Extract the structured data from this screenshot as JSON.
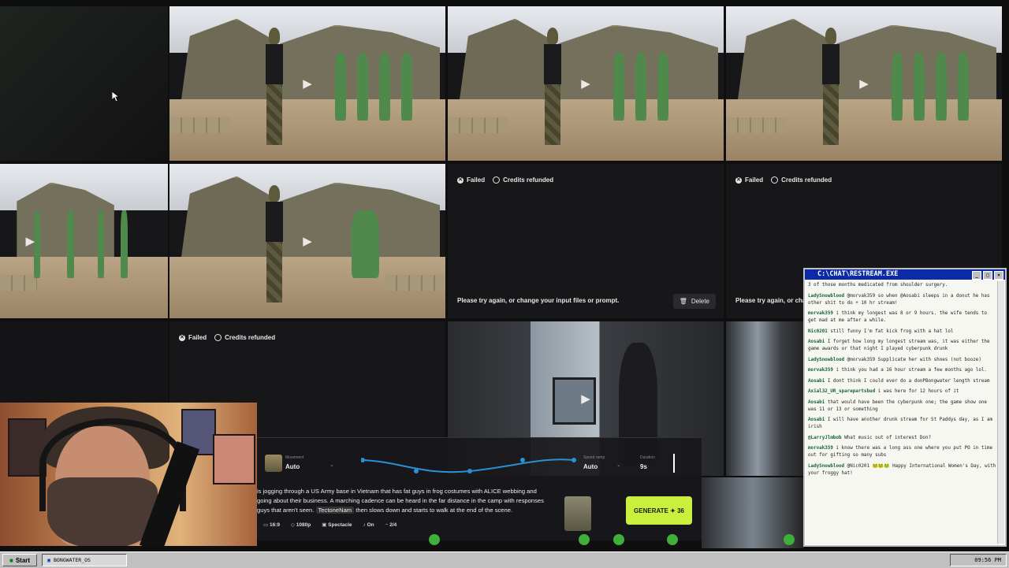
{
  "gallery": {
    "failed_status": "Failed",
    "credits_status": "Credits refunded",
    "retry_message": "Please try again, or change your input files or prompt.",
    "retry_message_cut": "Please try again, or char",
    "delete_label": "Delete"
  },
  "controls": {
    "movement_label": "Movement",
    "movement_value": "Auto",
    "speed_ramp_label": "Speed ramp",
    "speed_ramp_value": "Auto",
    "duration_label": "Duration",
    "duration_value": "9s"
  },
  "prompt": {
    "line1": "is jogging through a US Army base in Vietnam that has fat guys in frog costumes with ALICE webbing and",
    "line2": "going about their business. A marching cadence can be heard in the far distance in the camp with responses",
    "line3a": "guys that aren't seen.",
    "mention": "TectoneNam",
    "line3b": "then slows down and starts to walk at the end of the scene.",
    "ratio": "16:9",
    "resolution": "1080p",
    "style": "Spectacle",
    "audio": "On",
    "count": "2/4",
    "generate_label": "GENERATE",
    "generate_cost": "36"
  },
  "chat": {
    "title": "C:\\CHAT\\RESTREAM.EXE",
    "messages": [
      {
        "user": "",
        "text": "3 of those months medicated from shoulder surgery."
      },
      {
        "user": "LadySnowblood",
        "text": "@morvak359 so when @Aosabi sleeps in a donut he has other shit to do + 10 hr stream!"
      },
      {
        "user": "morvak359",
        "text": "i think my longest was 8 or 9 hours. the wife tends to get mad at me after a while."
      },
      {
        "user": "Nic0201",
        "text": "still funny I'm fat kick frog with a hat lol"
      },
      {
        "user": "Aosabi",
        "text": "I forget how long my longest stream was, it was either the game awards or that night I played cyberpunk drunk"
      },
      {
        "user": "LadySnowblood",
        "text": "@morvak359 Supplicate her with shoes (not booze)"
      },
      {
        "user": "morvak359",
        "text": "i think you had a 16 hour stream a few months ago lol."
      },
      {
        "user": "Aosabi",
        "text": "I dont think I could ever do a donPBongwater length stream"
      },
      {
        "user": "Axial32_UR_sparepartsbud",
        "text": "i was here for 12 hours of it"
      },
      {
        "user": "Aosabi",
        "text": "that would have been the cyberpunk one; the game show one was 11 or 13 or something"
      },
      {
        "user": "Aosabi",
        "text": "I will have another drunk stream for St Paddys day, as I am irish"
      },
      {
        "user": "@LarryJlmbob",
        "text": "What music out of interest Don?"
      },
      {
        "user": "morvak359",
        "text": "i know there was a long ass one where you put PO in time out for gifting so many subs"
      },
      {
        "user": "LadySnowblood",
        "text": "@Nic0201 🐸🐸🐸 Happy International Women's Day, with your froggy hat!"
      }
    ]
  },
  "taskbar": {
    "start_label": "Start",
    "window_label": "BONGWATER_OS",
    "clock": "09:56 PM"
  },
  "colors": {
    "generate_button": "#c8f03c",
    "chat_titlebar": "#0a2aa8",
    "chat_username": "#16623a",
    "taskbar": "#c0c0c0"
  }
}
